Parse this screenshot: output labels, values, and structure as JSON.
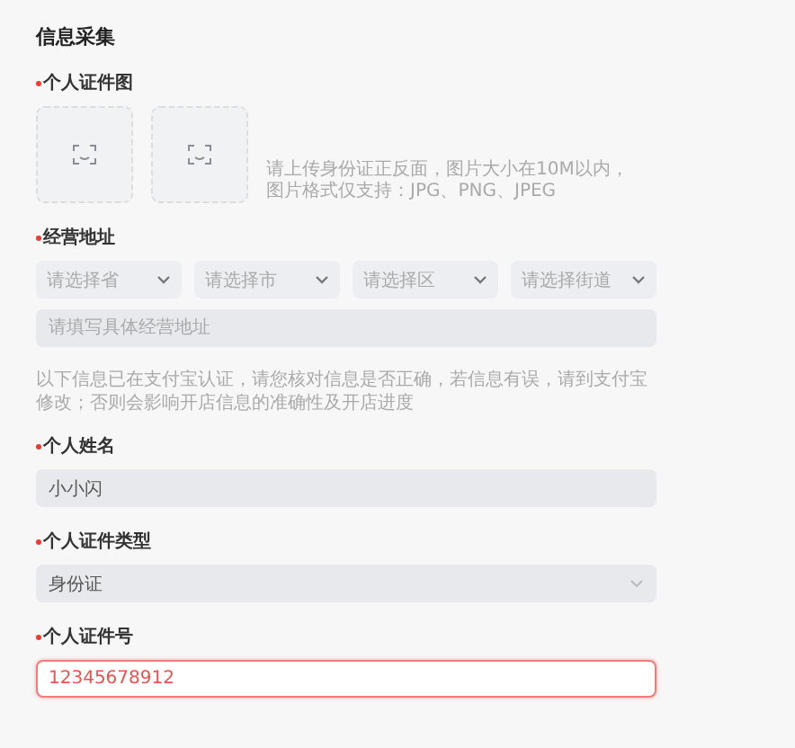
{
  "section_title": "信息采集",
  "fields": [
    {
      "kind": "upload",
      "label": "个人证件图",
      "required": true,
      "hint": [
        "请上传身份证正反面，图片大小在10M以内，",
        "图片格式仅支持：JPG、PNG、JPEG"
      ]
    },
    {
      "kind": "address",
      "label": "经营地址",
      "required": true,
      "selects": [
        {
          "placeholder": "请选择省"
        },
        {
          "placeholder": "请选择市"
        },
        {
          "placeholder": "请选择区"
        },
        {
          "placeholder": "请选择街道"
        }
      ],
      "placeholder": "请填写具体经营地址"
    },
    {
      "kind": "notice",
      "text": "以下信息已在支付宝认证，请您核对信息是否正确，若信息有误，请到支付宝修改；否则会影响开店信息的准确性及开店进度"
    },
    {
      "kind": "text",
      "label": "个人姓名",
      "required": true,
      "value": "小小闪",
      "disabled": true,
      "error": false
    },
    {
      "kind": "select",
      "label": "个人证件类型",
      "required": true,
      "value": "身份证",
      "disabled": true
    },
    {
      "kind": "text",
      "label": "个人证件号",
      "required": true,
      "value": "12345678912",
      "disabled": false,
      "error": true
    }
  ]
}
